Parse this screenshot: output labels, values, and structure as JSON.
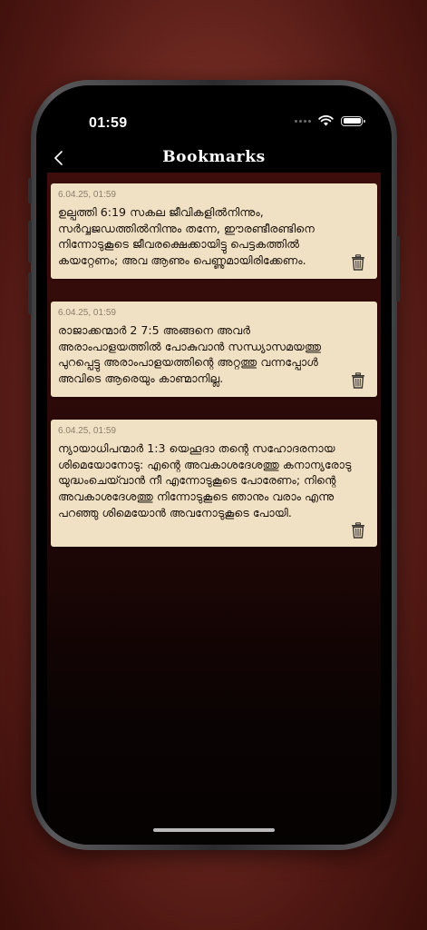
{
  "status": {
    "time": "01:59"
  },
  "nav": {
    "title": "Bookmarks"
  },
  "bookmarks": [
    {
      "timestamp": "6.04.25, 01:59",
      "text": "ഉല്പത്തി 6:19 സകല ജീവികളിൽനിന്നും, സർവ്വജഡത്തിൽനിന്നും തന്നേ, ഈരണ്ടീരണ്ടിനെ നിന്നോടുകൂടെ ജീവരക്ഷെക്കായിട്ടു പെട്ടകത്തിൽ കയറ്റേണം; അവ ആണും പെണ്ണുമായിരിക്കേണം."
    },
    {
      "timestamp": "6.04.25, 01:59",
      "text": "രാജാക്കന്മാർ 2 7:5 അങ്ങനെ അവർ അരാംപാളയത്തിൽ പോകുവാൻ സന്ധ്യാസമയത്തു പുറപ്പെട്ടു അരാംപാളയത്തിന്റെ അറ്റത്തു വന്നപ്പോൾ അവിടെ ആരെയും കാണ്മാനില്ല."
    },
    {
      "timestamp": "6.04.25, 01:59",
      "text": "ന്യായാധിപന്മാർ 1:3 യെഹൂദാ തന്റെ സഹോദരനായ ശിമെയോനോടു: എന്റെ അവകാശദേശത്തു കനാന്യരോടു യുദ്ധംചെയ്‍വാൻ നീ എന്നോടുകൂടെ പോരേണം; നിന്റെ അവകാശദേശത്തു നിന്നോടുകൂടെ ഞാനും വരാം എന്നു പറഞ്ഞു ശിമെയോൻ അവനോടുകൂടെ പോയി."
    }
  ],
  "icons": {
    "back": "chevron-left-icon",
    "trash": "trash-icon",
    "wifi": "wifi-icon",
    "battery": "battery-icon",
    "signal": "signal-dots-icon"
  },
  "colors": {
    "card_bg": "#f1e1c4",
    "content_bg_top": "#3d0e0b",
    "content_bg_bottom": "#050202",
    "text": "#1a120c",
    "timestamp": "#8a7e6a",
    "outer_bg": "#6a241c"
  }
}
